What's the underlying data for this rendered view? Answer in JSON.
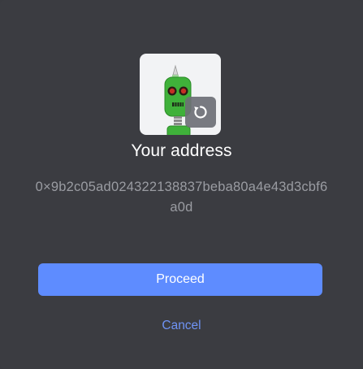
{
  "dialog": {
    "avatar": {
      "icon": "robot-avatar",
      "refresh_icon": "refresh-icon"
    },
    "title": "Your address",
    "address": "0×9b2c05ad024322138837beba80a4e43d3cbf6a0d",
    "proceed_label": "Proceed",
    "cancel_label": "Cancel"
  },
  "colors": {
    "background": "#3b3c41",
    "primary": "#5e8cff",
    "link": "#6f93f5",
    "muted_text": "#9a9ca2",
    "avatar_bg": "#f2f3f5",
    "robot_green": "#3fb13a"
  }
}
